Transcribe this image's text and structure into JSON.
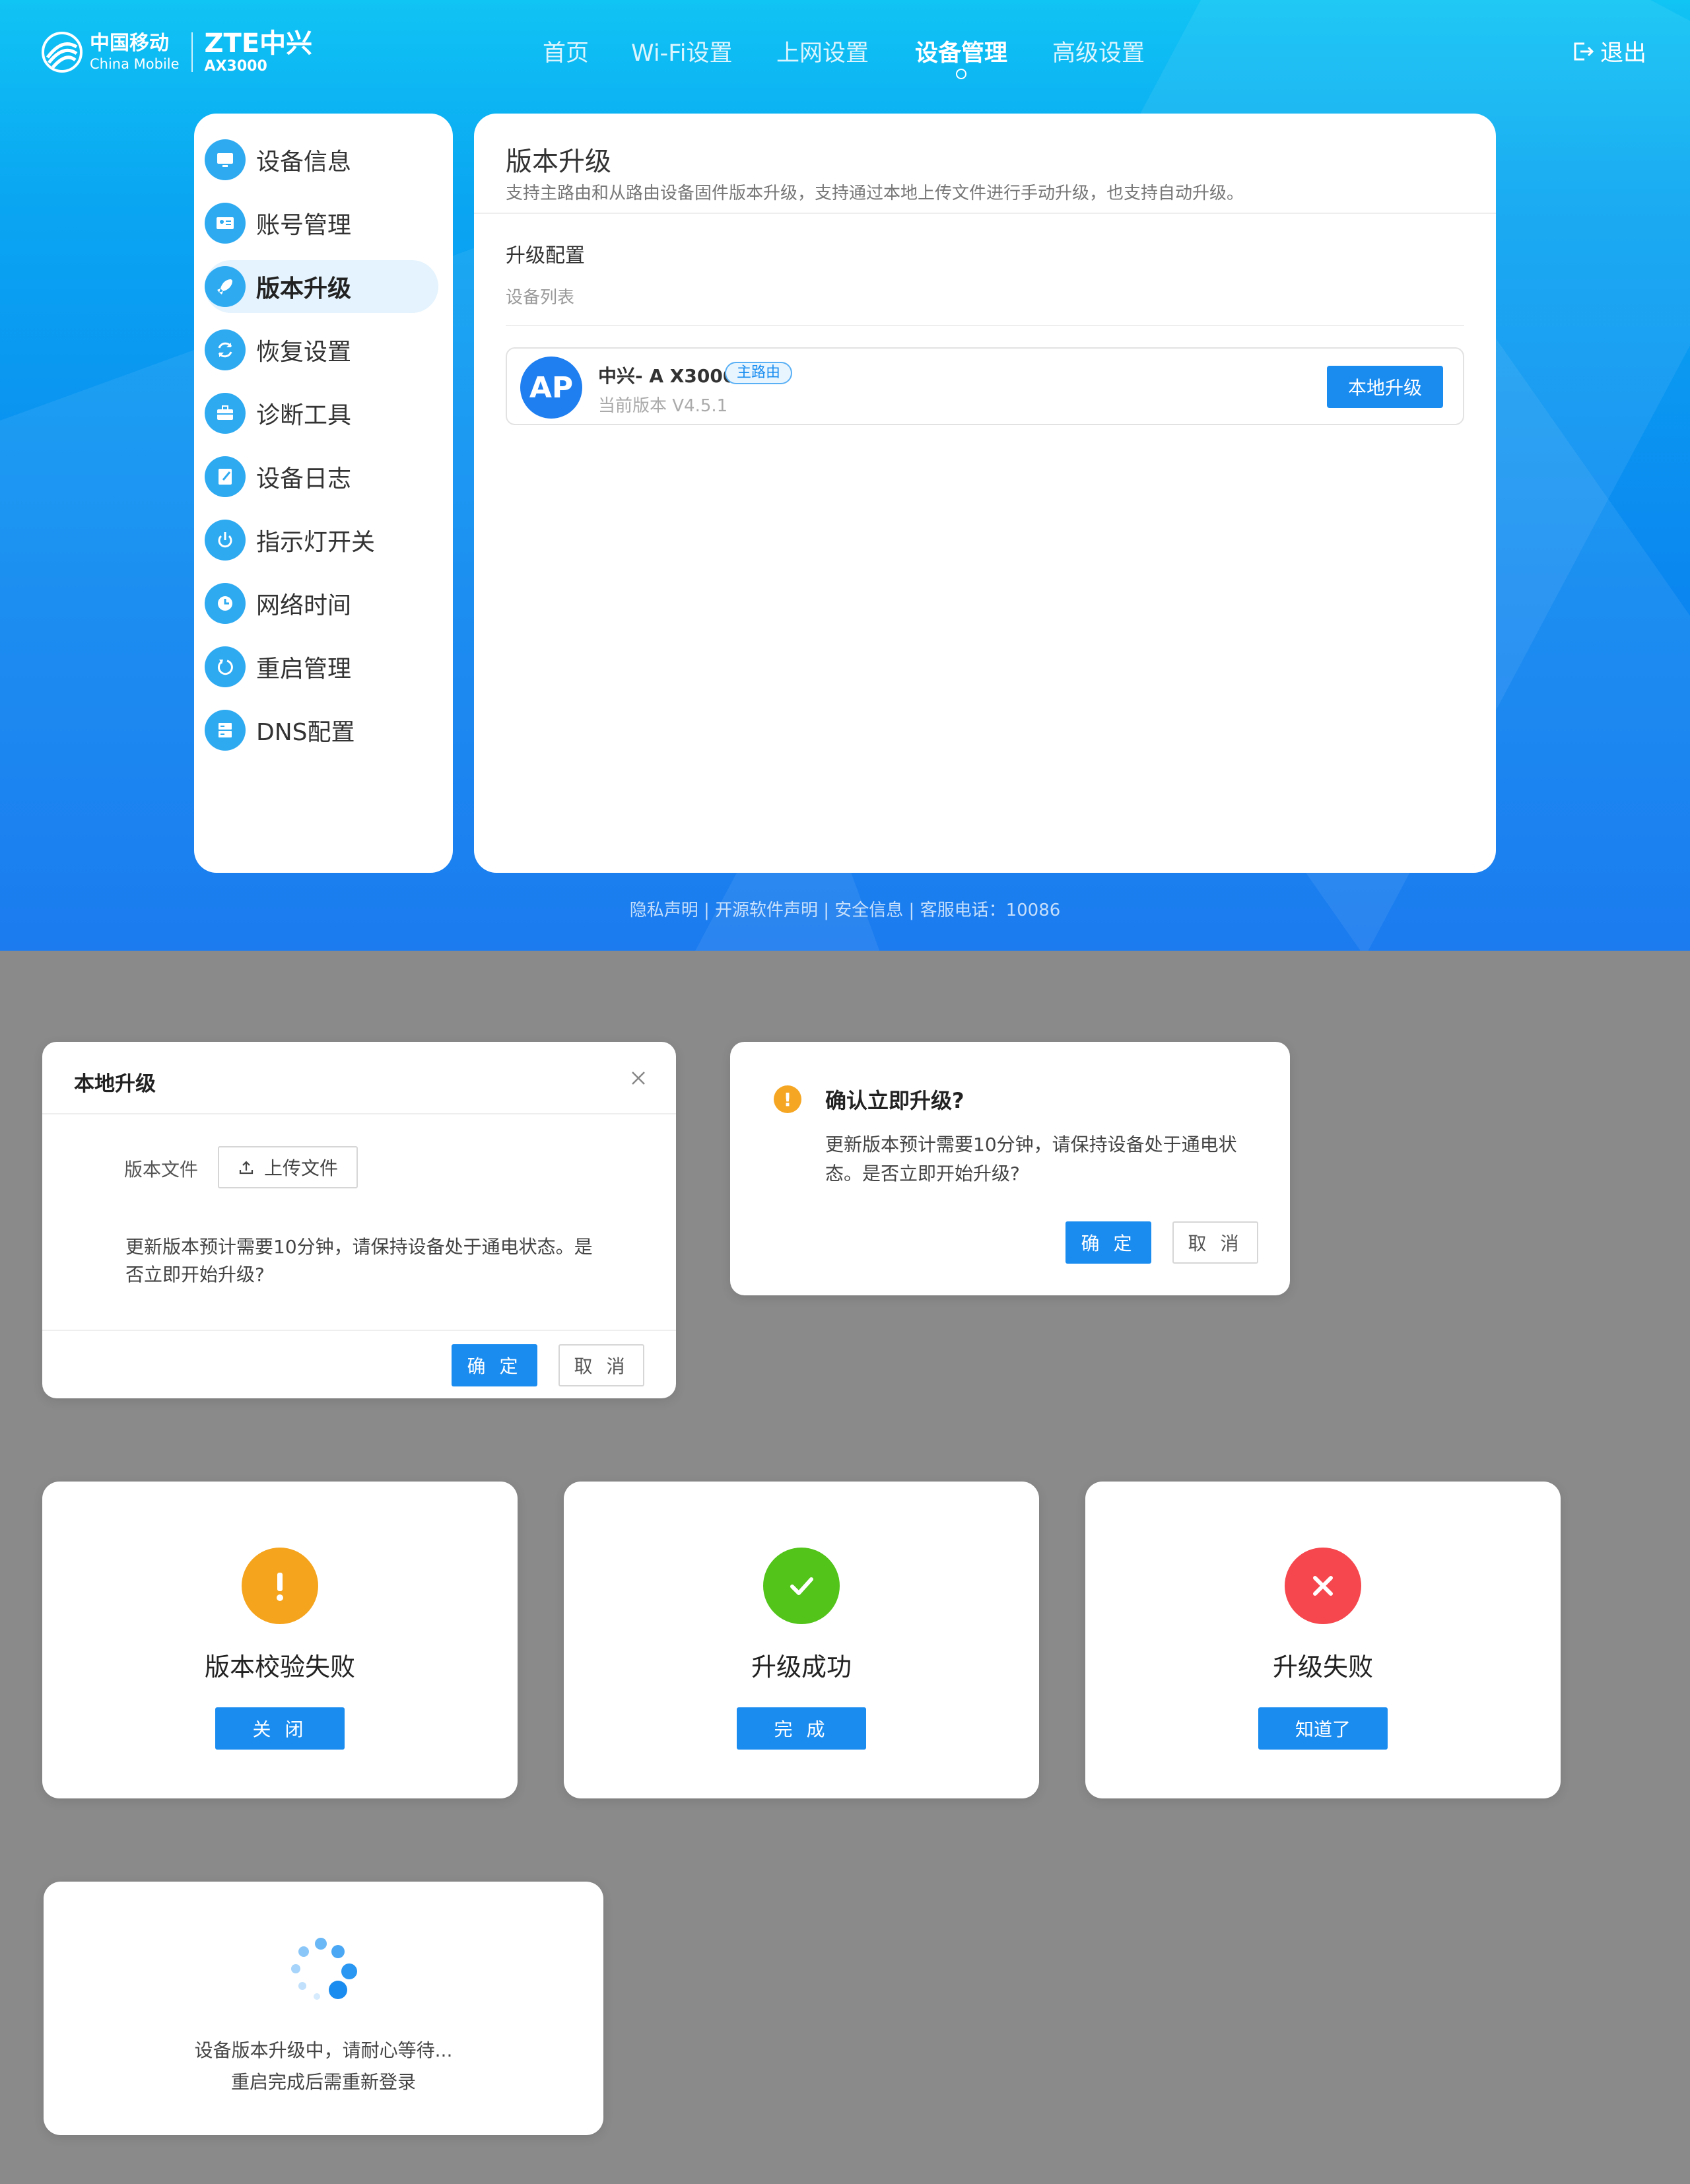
{
  "header": {
    "brand_cn": "中国移动",
    "brand_en": "China Mobile",
    "brand_zte": "ZTE中兴",
    "model": "AX3000",
    "nav": [
      "首页",
      "Wi-Fi设置",
      "上网设置",
      "设备管理",
      "高级设置"
    ],
    "active_nav": "设备管理",
    "logout": "退出"
  },
  "sidebar": {
    "items": [
      {
        "label": "设备信息",
        "icon": "monitor-icon"
      },
      {
        "label": "账号管理",
        "icon": "id-card-icon"
      },
      {
        "label": "版本升级",
        "icon": "rocket-icon"
      },
      {
        "label": "恢复设置",
        "icon": "restore-icon"
      },
      {
        "label": "诊断工具",
        "icon": "toolbox-icon"
      },
      {
        "label": "设备日志",
        "icon": "log-icon"
      },
      {
        "label": "指示灯开关",
        "icon": "power-icon"
      },
      {
        "label": "网络时间",
        "icon": "clock-icon"
      },
      {
        "label": "重启管理",
        "icon": "reboot-icon"
      },
      {
        "label": "DNS配置",
        "icon": "server-icon"
      }
    ],
    "active": "版本升级"
  },
  "main": {
    "title": "版本升级",
    "desc": "支持主路由和从路由设备固件版本升级，支持通过本地上传文件进行手动升级，也支持自动升级。",
    "section": "升级配置",
    "sub": "设备列表",
    "device": {
      "avatar": "AP",
      "name": "中兴- A X3000",
      "tag": "主路由",
      "version": "当前版本  V4.5.1",
      "button": "本地升级"
    }
  },
  "footer": "隐私声明 | 开源软件声明 | 安全信息 | 客服电话：10086",
  "local_upgrade_dialog": {
    "title": "本地升级",
    "file_label": "版本文件",
    "upload": "上传文件",
    "message": "更新版本预计需要10分钟，请保持设备处于通电状态。是否立即开始升级?",
    "ok": "确 定",
    "cancel": "取 消"
  },
  "confirm_dialog": {
    "title": "确认立即升级?",
    "message": "更新版本预计需要10分钟，请保持设备处于通电状态。是否立即开始升级?",
    "ok": "确 定",
    "cancel": "取 消"
  },
  "results": [
    {
      "title": "版本校验失败",
      "button": "关 闭",
      "icon": "warning-icon",
      "color": "#f5a41e"
    },
    {
      "title": "升级成功",
      "button": "完 成",
      "icon": "check-icon",
      "color": "#52c41a"
    },
    {
      "title": "升级失败",
      "button": "知道了",
      "icon": "error-icon",
      "color": "#f5474d"
    }
  ],
  "loading": {
    "line1": "设备版本升级中，请耐心等待...",
    "line2": "重启完成后需重新登录",
    "icon": "spinner-icon"
  },
  "colors": {
    "primary": "#1a8cf0",
    "header": "#0aa6f2",
    "sidebar_icon": "#2eaaf1"
  }
}
